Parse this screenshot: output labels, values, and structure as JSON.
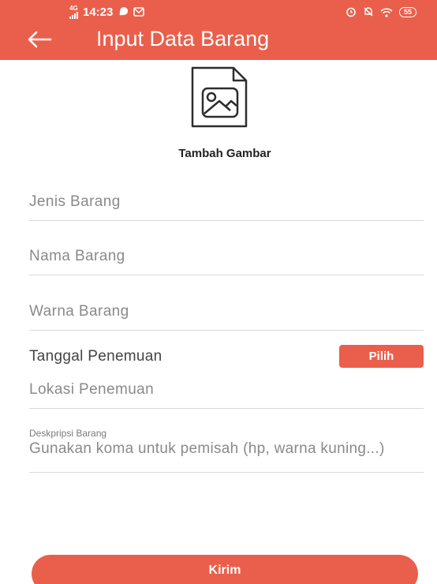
{
  "status_bar": {
    "network": "4G",
    "time": "14:23",
    "battery": "55",
    "icons": [
      "signal-icon",
      "location-icon",
      "message-icon",
      "alarm-icon",
      "mute-icon",
      "wifi-icon",
      "battery-icon"
    ]
  },
  "header": {
    "title": "Input Data Barang",
    "back_icon": "arrow-left-icon"
  },
  "image_picker": {
    "icon": "image-file-icon",
    "label": "Tambah Gambar"
  },
  "form": {
    "jenis_barang": {
      "placeholder": "Jenis Barang",
      "value": ""
    },
    "nama_barang": {
      "placeholder": "Nama Barang",
      "value": ""
    },
    "warna_barang": {
      "placeholder": "Warna Barang",
      "value": ""
    },
    "tanggal": {
      "label": "Tanggal Penemuan",
      "button_label": "Pilih"
    },
    "lokasi": {
      "placeholder": "Lokasi Penemuan",
      "value": ""
    },
    "deskripsi": {
      "label": "Deskpripsi Barang",
      "placeholder": "Gunakan koma untuk pemisah (hp, warna kuning...)",
      "value": ""
    }
  },
  "submit_label": "Kirim",
  "colors": {
    "primary": "#ea5f4b",
    "text": "#333333",
    "placeholder": "#8a8a8a",
    "divider": "#d9d9d9"
  }
}
